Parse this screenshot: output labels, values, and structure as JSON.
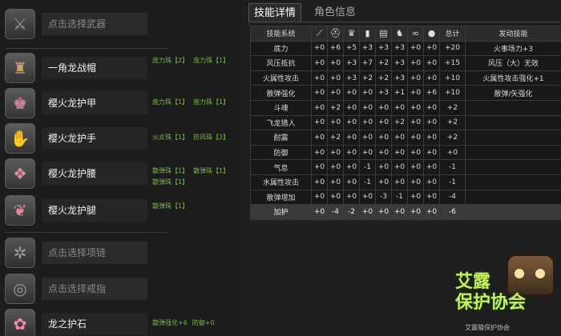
{
  "left": {
    "weapon": {
      "label": "点击选择武器",
      "icon": "weapon-slot-icon"
    },
    "armor": [
      {
        "name": "一角龙战帽",
        "icon": "helmet-icon",
        "gems": [
          "庞力珠【2】",
          "庞力珠【1】"
        ]
      },
      {
        "name": "樱火龙护甲",
        "icon": "chest-armor-icon",
        "gems": [
          "庞力珠【1】",
          "庞力珠【1】"
        ]
      },
      {
        "name": "樱火龙护手",
        "icon": "gauntlet-icon",
        "gems": [
          "火炎珠【1】",
          "防风珠【2】"
        ]
      },
      {
        "name": "樱火龙护腰",
        "icon": "waist-armor-icon",
        "gems": [
          "散弹珠【1】",
          "散弹珠【1】",
          "散弹珠【1】"
        ]
      },
      {
        "name": "樱火龙护腿",
        "icon": "leg-armor-icon",
        "gems": [
          "散弹珠【1】"
        ]
      }
    ],
    "necklace": {
      "label": "点击选择项链",
      "icon": "necklace-slot-icon"
    },
    "ring": {
      "label": "点击选择戒指",
      "icon": "ring-slot-icon"
    },
    "charm": {
      "name": "龙之护石",
      "icon": "charm-stone-icon",
      "gems": [
        "散弹强化+6",
        "防御+0"
      ]
    }
  },
  "tabs": {
    "skills": "技能详情",
    "character": "角色信息"
  },
  "table": {
    "header_label": "技能系统",
    "header_total": "总计",
    "header_skill": "发动技能",
    "header_icons": [
      "weapon-icon",
      "helmet-icon",
      "chest-icon",
      "arm-icon",
      "waist-icon",
      "leg-icon",
      "jewel-icon",
      "charm-icon"
    ],
    "rows": [
      {
        "name": "底力",
        "v": [
          "+0",
          "+6",
          "+5",
          "+3",
          "+3",
          "+3",
          "+0",
          "+0"
        ],
        "total": "+20",
        "skill": "火事场力+3"
      },
      {
        "name": "风压抵抗",
        "v": [
          "+0",
          "+0",
          "+3",
          "+7",
          "+2",
          "+3",
          "+0",
          "+0"
        ],
        "total": "+15",
        "skill": "风压（大）无效"
      },
      {
        "name": "火属性攻击",
        "v": [
          "+0",
          "+0",
          "+3",
          "+2",
          "+2",
          "+3",
          "+0",
          "+0"
        ],
        "total": "+10",
        "skill": "火属性攻击强化+1"
      },
      {
        "name": "散弹强化",
        "v": [
          "+0",
          "+0",
          "+0",
          "+0",
          "+3",
          "+1",
          "+0",
          "+6"
        ],
        "total": "+10",
        "skill": "散弹/矢强化"
      },
      {
        "name": "斗魂",
        "v": [
          "+0",
          "+2",
          "+0",
          "+0",
          "+0",
          "+0",
          "+0",
          "+0"
        ],
        "total": "+2",
        "skill": ""
      },
      {
        "name": "飞龙猎人",
        "v": [
          "+0",
          "+0",
          "+0",
          "+0",
          "+0",
          "+2",
          "+0",
          "+0"
        ],
        "total": "+2",
        "skill": ""
      },
      {
        "name": "耐震",
        "v": [
          "+0",
          "+2",
          "+0",
          "+0",
          "+0",
          "+0",
          "+0",
          "+0"
        ],
        "total": "+2",
        "skill": ""
      },
      {
        "name": "防御",
        "v": [
          "+0",
          "+0",
          "+0",
          "+0",
          "+0",
          "+0",
          "+0",
          "+0"
        ],
        "total": "+0",
        "skill": ""
      },
      {
        "name": "气息",
        "v": [
          "+0",
          "+0",
          "+0",
          "-1",
          "+0",
          "+0",
          "+0",
          "+0"
        ],
        "total": "-1",
        "skill": ""
      },
      {
        "name": "水属性攻击",
        "v": [
          "+0",
          "+0",
          "+0",
          "-1",
          "+0",
          "+0",
          "+0",
          "+0"
        ],
        "total": "-1",
        "skill": ""
      },
      {
        "name": "散弹增加",
        "v": [
          "+0",
          "+0",
          "+0",
          "+0",
          "-3",
          "-1",
          "+0",
          "+0"
        ],
        "total": "-4",
        "skill": ""
      },
      {
        "name": "加护",
        "v": [
          "+0",
          "-4",
          "-2",
          "+0",
          "+0",
          "+0",
          "+0",
          "+0"
        ],
        "total": "-6",
        "skill": ""
      }
    ]
  },
  "watermark": {
    "title": "艾露",
    "title2": "保护协会",
    "sub": "艾露猫保护协会"
  }
}
